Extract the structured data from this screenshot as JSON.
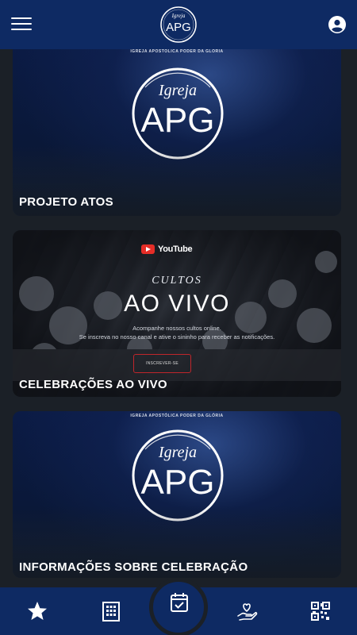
{
  "header": {
    "logo_script": "Igreja",
    "logo_text": "APG",
    "menu_icon": "hamburger-menu-icon",
    "profile_icon": "account-circle-icon"
  },
  "cards": [
    {
      "subtitle": "IGREJA APOSTÓLICA PODER DA GLÓRIA",
      "emblem_script": "Igreja",
      "emblem_text": "APG",
      "title": "PROJETO ATOS"
    },
    {
      "youtube": "YouTube",
      "cultos": "CULTOS",
      "headline": "AO VIVO",
      "desc_line1": "Acompanhe nossos cultos online.",
      "desc_line2": "Se inscreva no nosso canal e ative o sininho para receber as notificações.",
      "subscribe": "INSCREVER-SE",
      "title": "CELEBRAÇÕES AO VIVO"
    },
    {
      "subtitle": "IGREJA APOSTÓLICA PODER DA GLÓRIA",
      "emblem_script": "Igreja",
      "emblem_text": "APG",
      "title": "INFORMAÇÕES SOBRE CELEBRAÇÃO"
    }
  ],
  "bottom_nav": {
    "items": [
      "star-icon",
      "building-icon",
      "calendar-check-icon",
      "heart-hand-icon",
      "qr-code-icon"
    ]
  },
  "colors": {
    "primary": "#0e2a63",
    "background": "#1b2027",
    "youtube_red": "#e52d27"
  }
}
